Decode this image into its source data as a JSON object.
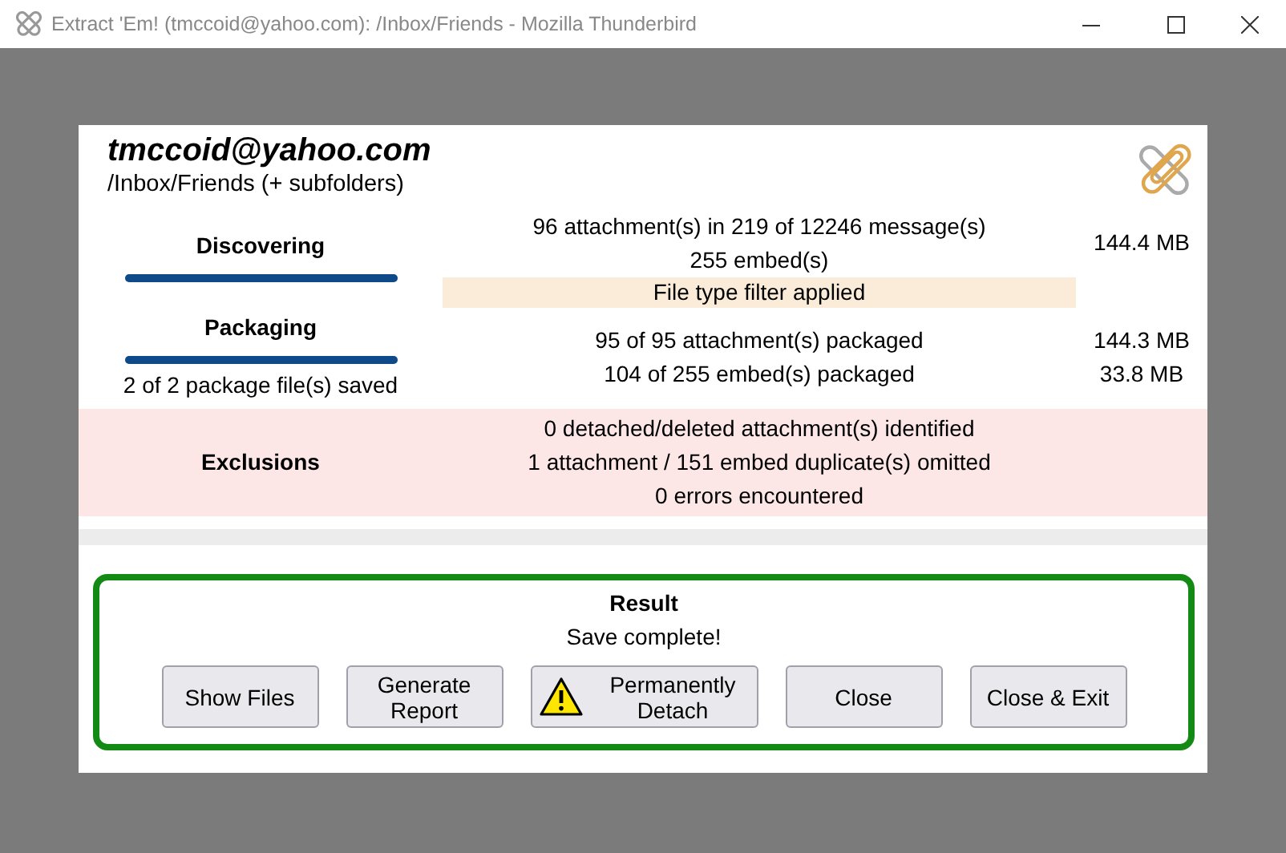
{
  "window": {
    "title": "Extract 'Em! (tmccoid@yahoo.com): /Inbox/Friends - Mozilla Thunderbird"
  },
  "account": "tmccoid@yahoo.com",
  "folder": "/Inbox/Friends (+ subfolders)",
  "stages": [
    {
      "label": "Discovering",
      "level": 1,
      "lines": [
        "96 attachment(s) in 219 of 12246 message(s)",
        "255 embed(s)"
      ],
      "sizes": [
        "144.4 MB"
      ],
      "note": "File type filter applied"
    },
    {
      "label": "Packaging",
      "level": 1,
      "status": "2 of 2 package file(s) saved",
      "lines": [
        "95 of 95 attachment(s) packaged",
        "104 of 255 embed(s) packaged"
      ],
      "sizes": [
        "144.3 MB",
        "33.8 MB"
      ]
    }
  ],
  "exclusions": {
    "label": "Exclusions",
    "lines": [
      "0 detached/deleted attachment(s) identified",
      "1 attachment / 151 embed duplicate(s) omitted",
      "0 errors encountered"
    ]
  },
  "result": {
    "title": "Result",
    "message": "Save complete!"
  },
  "buttons": [
    {
      "label": "Show Files",
      "kind": "plain"
    },
    {
      "label": "Generate Report",
      "kind": "plain"
    },
    {
      "label": "Permanently Detach",
      "kind": "warning"
    },
    {
      "label": "Close",
      "kind": "plain"
    },
    {
      "label": "Close & Exit",
      "kind": "plain"
    }
  ]
}
